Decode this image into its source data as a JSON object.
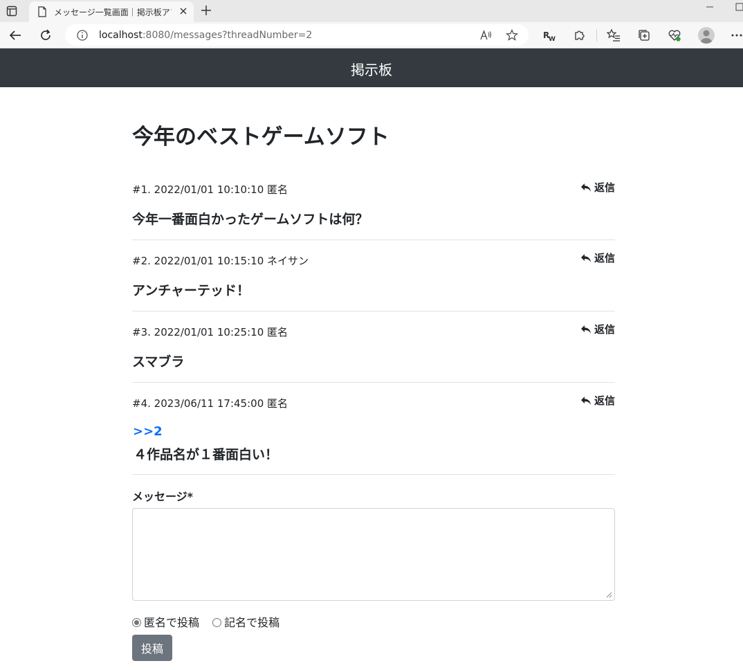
{
  "browser": {
    "tab_title": "メッセージ一覧画面｜掲示板アプリ",
    "url_host": "localhost",
    "url_rest": ":8080/messages?threadNumber=2",
    "icons": [
      "tab-actions-icon",
      "page-icon",
      "close-icon",
      "plus-icon",
      "back-arrow-icon",
      "refresh-icon",
      "info-icon",
      "read-aloud-icon",
      "star-icon",
      "reader-icon",
      "puzzle-icon",
      "favorites-icon",
      "collections-icon",
      "heart-pulse-icon",
      "profile-icon",
      "more-icon"
    ]
  },
  "navbar": {
    "brand": "掲示板"
  },
  "thread": {
    "title": "今年のベストゲームソフト"
  },
  "messages": [
    {
      "meta": "#1. 2022/01/01 10:10:10 匿名",
      "reply_label": "返信",
      "body": "今年一番面白かったゲームソフトは何？"
    },
    {
      "meta": "#2. 2022/01/01 10:15:10 ネイサン",
      "reply_label": "返信",
      "body": "アンチャーテッド！"
    },
    {
      "meta": "#3. 2022/01/01 10:25:10 匿名",
      "reply_label": "返信",
      "body": "スマブラ"
    },
    {
      "meta": "#4. 2023/06/11 17:45:00 匿名",
      "reply_label": "返信",
      "anchor": ">>2",
      "body": "４作品名が１番面白い！"
    }
  ],
  "form": {
    "label": "メッセージ*",
    "textarea_value": "",
    "radio_anonymous": "匿名で投稿",
    "radio_named": "記名で投稿",
    "selected": "匿名で投稿",
    "submit_label": "投稿"
  },
  "colors": {
    "navbar": "#343a40",
    "link": "#0d6efd",
    "button": "#6c757d"
  }
}
